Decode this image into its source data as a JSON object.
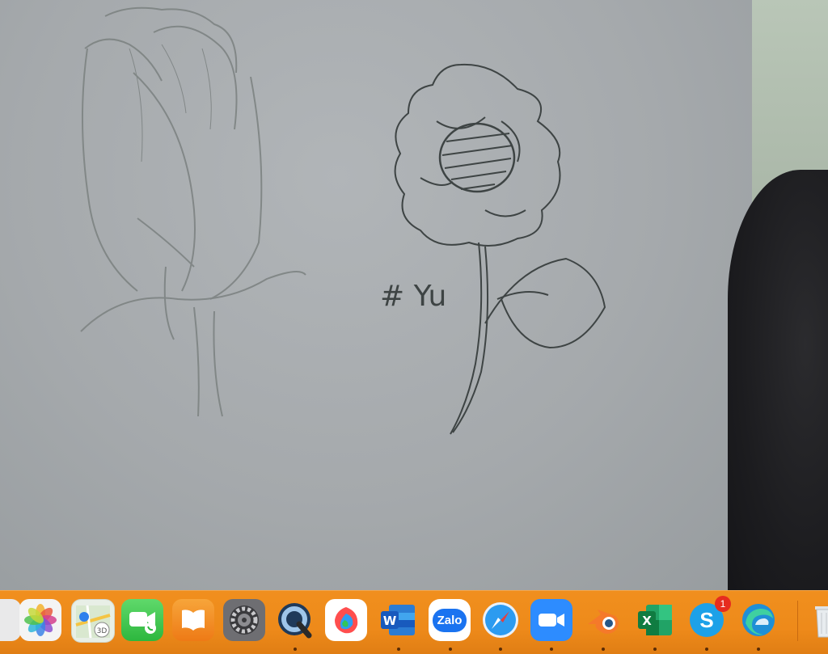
{
  "sketch": {
    "signature": "# Yu"
  },
  "dock": {
    "apps": [
      {
        "name": "Photos",
        "icon": "photos-icon"
      },
      {
        "name": "Maps",
        "icon": "maps-icon",
        "label": "3D"
      },
      {
        "name": "FaceTime",
        "icon": "facetime-icon"
      },
      {
        "name": "Books",
        "icon": "books-icon"
      },
      {
        "name": "System Preferences",
        "icon": "gear-icon"
      },
      {
        "name": "QuickTime Player",
        "icon": "quicktime-icon"
      },
      {
        "name": "MediBang Paint",
        "icon": "paint-icon"
      },
      {
        "name": "Microsoft Word",
        "icon": "word-icon",
        "label": "W"
      },
      {
        "name": "Zalo",
        "icon": "zalo-icon",
        "label": "Zalo"
      },
      {
        "name": "Safari",
        "icon": "safari-icon"
      },
      {
        "name": "Zoom",
        "icon": "zoom-icon"
      },
      {
        "name": "Blender",
        "icon": "blender-icon"
      },
      {
        "name": "Microsoft Excel",
        "icon": "excel-icon",
        "label": "X"
      },
      {
        "name": "Skype",
        "icon": "skype-icon",
        "label": "S",
        "badge": "1"
      },
      {
        "name": "Microsoft Edge",
        "icon": "edge-icon"
      },
      {
        "name": "Trash",
        "icon": "trash-icon"
      }
    ],
    "accent": "#ee8a1a"
  }
}
